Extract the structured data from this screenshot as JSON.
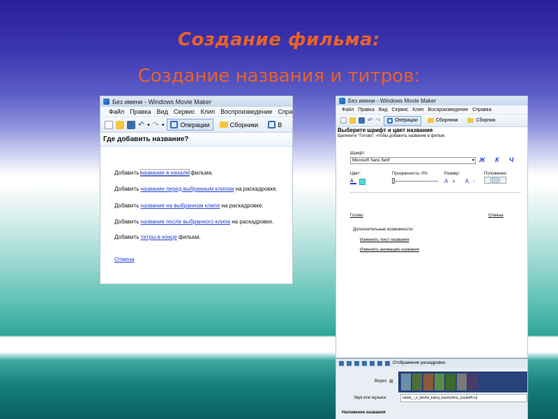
{
  "slide": {
    "title": "Создание фильма:",
    "subtitle": "Создание названия и титров:"
  },
  "left_window": {
    "title": "Без имени - Windows Movie Maker",
    "menu": [
      "Файл",
      "Правка",
      "Вид",
      "Сервис",
      "Клип",
      "Воспроизведение",
      "Справ"
    ],
    "toolbar": {
      "operations": "Операции",
      "collections": "Сборники",
      "extra": "В"
    },
    "heading": "Где добавить название?",
    "options": [
      {
        "prefix": "Добавить ",
        "link": "название в начале",
        "suffix": " фильма."
      },
      {
        "prefix": "Добавить ",
        "link": "название перед выбранным клипом",
        "suffix": " на раскадровке."
      },
      {
        "prefix": "Добавить ",
        "link": "название на выбранном клипе",
        "suffix": " на раскадровке."
      },
      {
        "prefix": "Добавить ",
        "link": "название после выбранного клипа",
        "suffix": " на раскадровке."
      },
      {
        "prefix": "Добавить ",
        "link": "титры в конце",
        "suffix": " фильма."
      }
    ],
    "cancel": "Отмена"
  },
  "right_window": {
    "title": "Без имени - Windows Movie Maker",
    "menu": [
      "Файл",
      "Правка",
      "Вид",
      "Сервис",
      "Клип",
      "Воспроизведение",
      "Справка"
    ],
    "toolbar": {
      "operations": "Операции",
      "collections": "Сборники",
      "extra": "Сборник"
    },
    "heading": "Выберите шрифт и цвет названия",
    "subheading": "Щелкните \"Готово\", чтобы добавить название в фильм.",
    "font_label": "Шрифт:",
    "font_value": "Microsoft Sans Serif",
    "bold_italic": "Ж К Ч",
    "color_label": "Цвет:",
    "transparency_label": "Прозрачность:  0%",
    "size_label": "Размер:",
    "sizes": "A+ A-",
    "position_label": "Положение:",
    "done": "Готово",
    "cancel": "Отмена",
    "more_label": "Дополнительные возможности:",
    "more_links": [
      "Изменить текст названия",
      "Изменить анимацию названия"
    ],
    "timeline": {
      "toolbar_label": "Отображение раскадровки.",
      "video_label": "Видео",
      "audio_label": "Звук или музыка",
      "overlay_label": "Наложение названия",
      "audio_clip": "natali_-_o_boshe_kakoj_muzhchina_(zvukoff.ru)"
    }
  },
  "colors": {
    "title": "#e8622a",
    "link": "#1f3fd6"
  }
}
